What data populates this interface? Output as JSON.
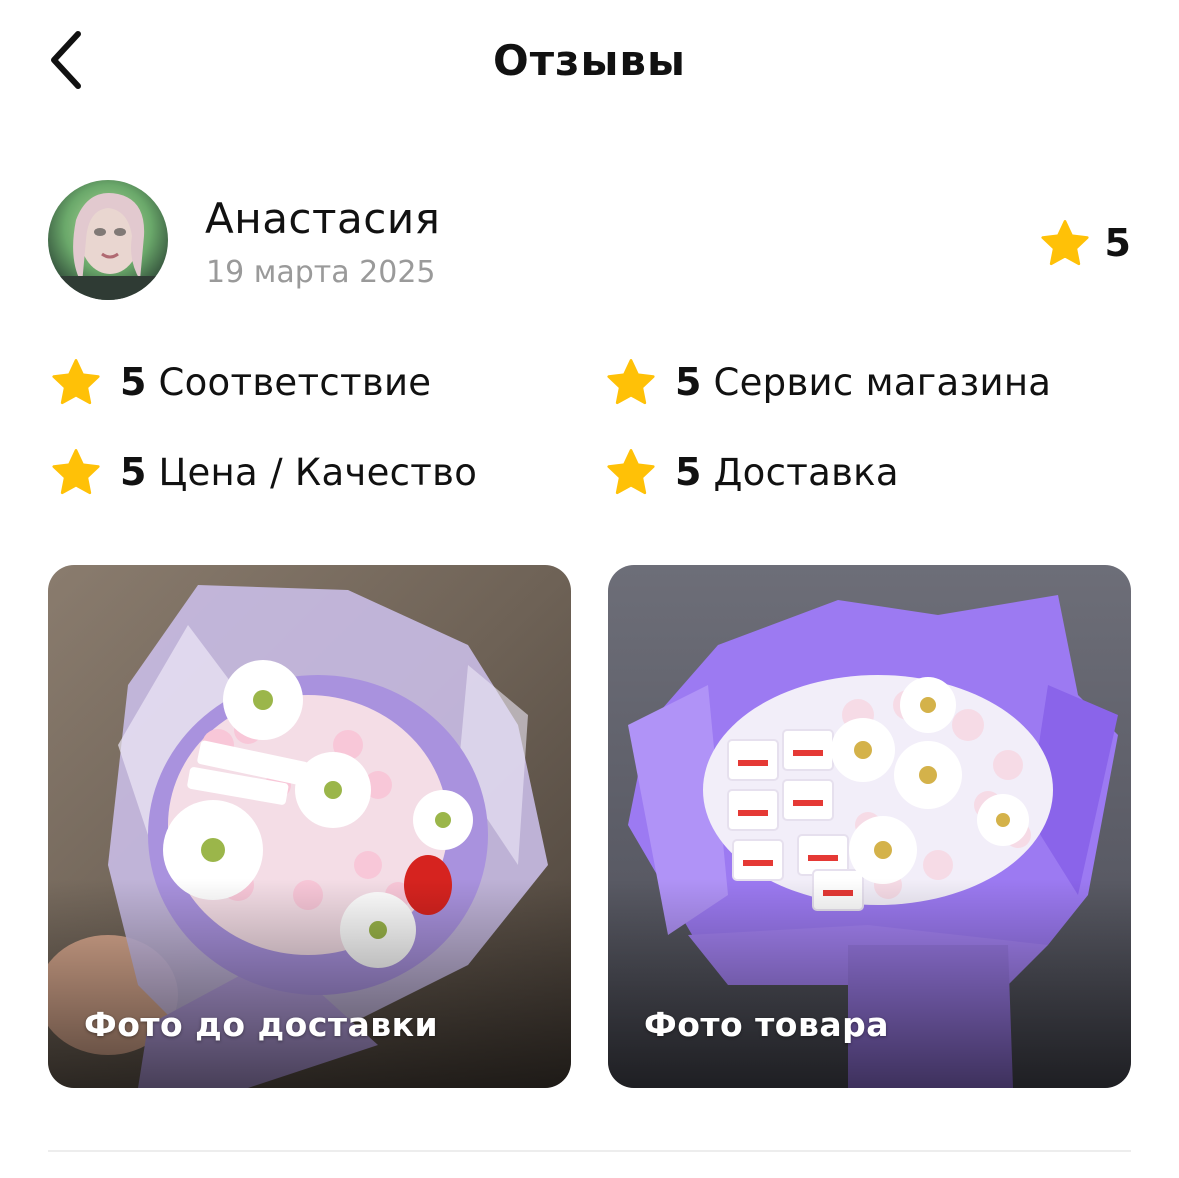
{
  "header": {
    "title": "Отзывы"
  },
  "review": {
    "author": "Анастасия",
    "date": "19 марта 2025",
    "rating": "5",
    "criteria": [
      {
        "score": "5",
        "label": "Соответствие"
      },
      {
        "score": "5",
        "label": "Сервис магазина"
      },
      {
        "score": "5",
        "label": "Цена / Качество"
      },
      {
        "score": "5",
        "label": "Доставка"
      }
    ],
    "photos": [
      {
        "caption": "Фото до доставки"
      },
      {
        "caption": "Фото товара"
      }
    ]
  },
  "colors": {
    "star": "#FFC107",
    "text": "#111111",
    "muted": "#9a9a9a",
    "wrap_purple": "#9b7bf0"
  }
}
